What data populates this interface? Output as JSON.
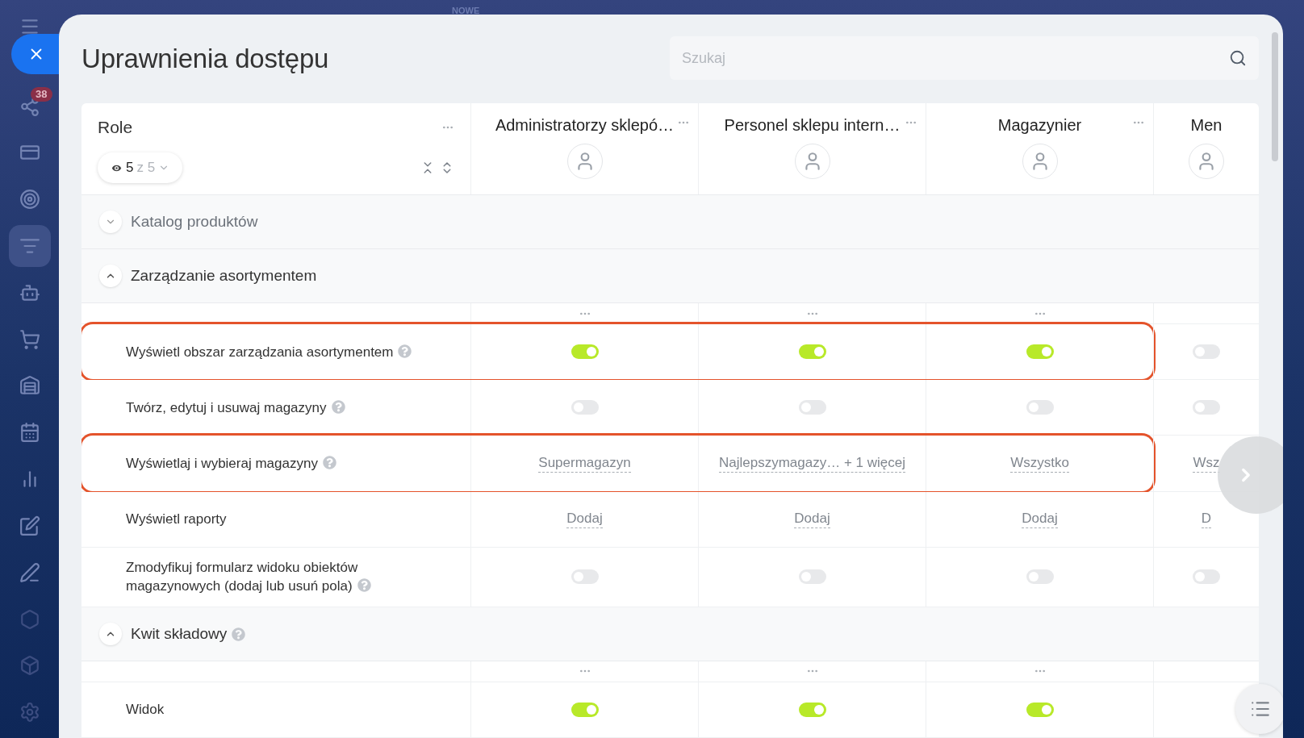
{
  "top_label": "NOWE",
  "sidebar": {
    "badge": "38"
  },
  "title": "Uprawnienia dostępu",
  "search": {
    "placeholder": "Szukaj"
  },
  "roles_header": {
    "label": "Role",
    "visible_count": "5",
    "total_label": "z 5"
  },
  "roles": [
    {
      "name": "Administratorzy sklepó…"
    },
    {
      "name": "Personel sklepu intern…"
    },
    {
      "name": "Magazynier"
    },
    {
      "name": "Men"
    }
  ],
  "sections": [
    {
      "title": "Katalog produktów",
      "expanded": false,
      "help": false
    },
    {
      "title": "Zarządzanie asortymentem",
      "expanded": true,
      "help": false,
      "rows": [
        {
          "label": "Wyświetl obszar zarządzania asortymentem",
          "help": true,
          "highlighted": true,
          "cells": [
            {
              "kind": "toggle",
              "on": true
            },
            {
              "kind": "toggle",
              "on": true
            },
            {
              "kind": "toggle",
              "on": true
            },
            {
              "kind": "toggle",
              "on": false
            }
          ]
        },
        {
          "label": "Twórz, edytuj i usuwaj magazyny",
          "help": true,
          "highlighted": false,
          "cells": [
            {
              "kind": "toggle",
              "on": false
            },
            {
              "kind": "toggle",
              "on": false
            },
            {
              "kind": "toggle",
              "on": false
            },
            {
              "kind": "toggle",
              "on": false
            }
          ]
        },
        {
          "label": "Wyświetlaj i wybieraj magazyny",
          "help": true,
          "highlighted": true,
          "cells": [
            {
              "kind": "select",
              "text": "Supermagazyn"
            },
            {
              "kind": "select",
              "text": "Najlepszymagazy… + 1 więcej"
            },
            {
              "kind": "select",
              "text": "Wszystko"
            },
            {
              "kind": "select",
              "text": "Wsz"
            }
          ]
        },
        {
          "label": "Wyświetl raporty",
          "help": false,
          "highlighted": false,
          "cells": [
            {
              "kind": "select",
              "text": "Dodaj"
            },
            {
              "kind": "select",
              "text": "Dodaj"
            },
            {
              "kind": "select",
              "text": "Dodaj"
            },
            {
              "kind": "select",
              "text": "D"
            }
          ]
        },
        {
          "label": "Zmodyfikuj formularz widoku obiektów magazynowych (dodaj lub usuń pola)",
          "help": true,
          "highlighted": false,
          "cells": [
            {
              "kind": "toggle",
              "on": false
            },
            {
              "kind": "toggle",
              "on": false
            },
            {
              "kind": "toggle",
              "on": false
            },
            {
              "kind": "toggle",
              "on": false
            }
          ]
        }
      ]
    },
    {
      "title": "Kwit składowy",
      "expanded": true,
      "help": true,
      "rows": [
        {
          "label": "Widok",
          "help": false,
          "highlighted": false,
          "cells": [
            {
              "kind": "toggle",
              "on": true
            },
            {
              "kind": "toggle",
              "on": true
            },
            {
              "kind": "toggle",
              "on": true
            }
          ]
        }
      ]
    }
  ]
}
